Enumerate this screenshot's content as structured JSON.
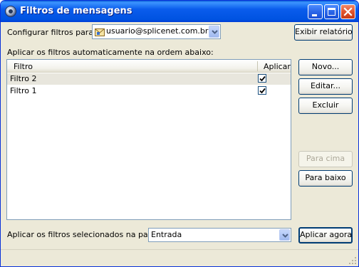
{
  "window": {
    "title": "Filtros de mensagens",
    "icon": "app-icon"
  },
  "account": {
    "label": "Configurar filtros para:",
    "selected": "usuario@splicenet.com.br",
    "icon": "mail-account-icon"
  },
  "buttons": {
    "report": "Exibir relatório",
    "new": "Novo...",
    "edit": "Editar...",
    "delete": "Excluir",
    "move_up": "Para cima",
    "move_down": "Para baixo",
    "apply_now": "Aplicar agora"
  },
  "auto_label": "Aplicar os filtros automaticamente na ordem abaixo:",
  "filters_table": {
    "columns": [
      "Filtro",
      "Aplicar"
    ],
    "rows": [
      {
        "name": "Filtro 2",
        "apply": true,
        "selected": true
      },
      {
        "name": "Filtro 1",
        "apply": true,
        "selected": false
      }
    ]
  },
  "folder": {
    "label": "Aplicar os filtros selecionados na pasta:",
    "selected": "Entrada"
  },
  "colors": {
    "title_bar": "#0054e3",
    "window_bg": "#ece9d8",
    "field_border": "#7f9db9"
  }
}
